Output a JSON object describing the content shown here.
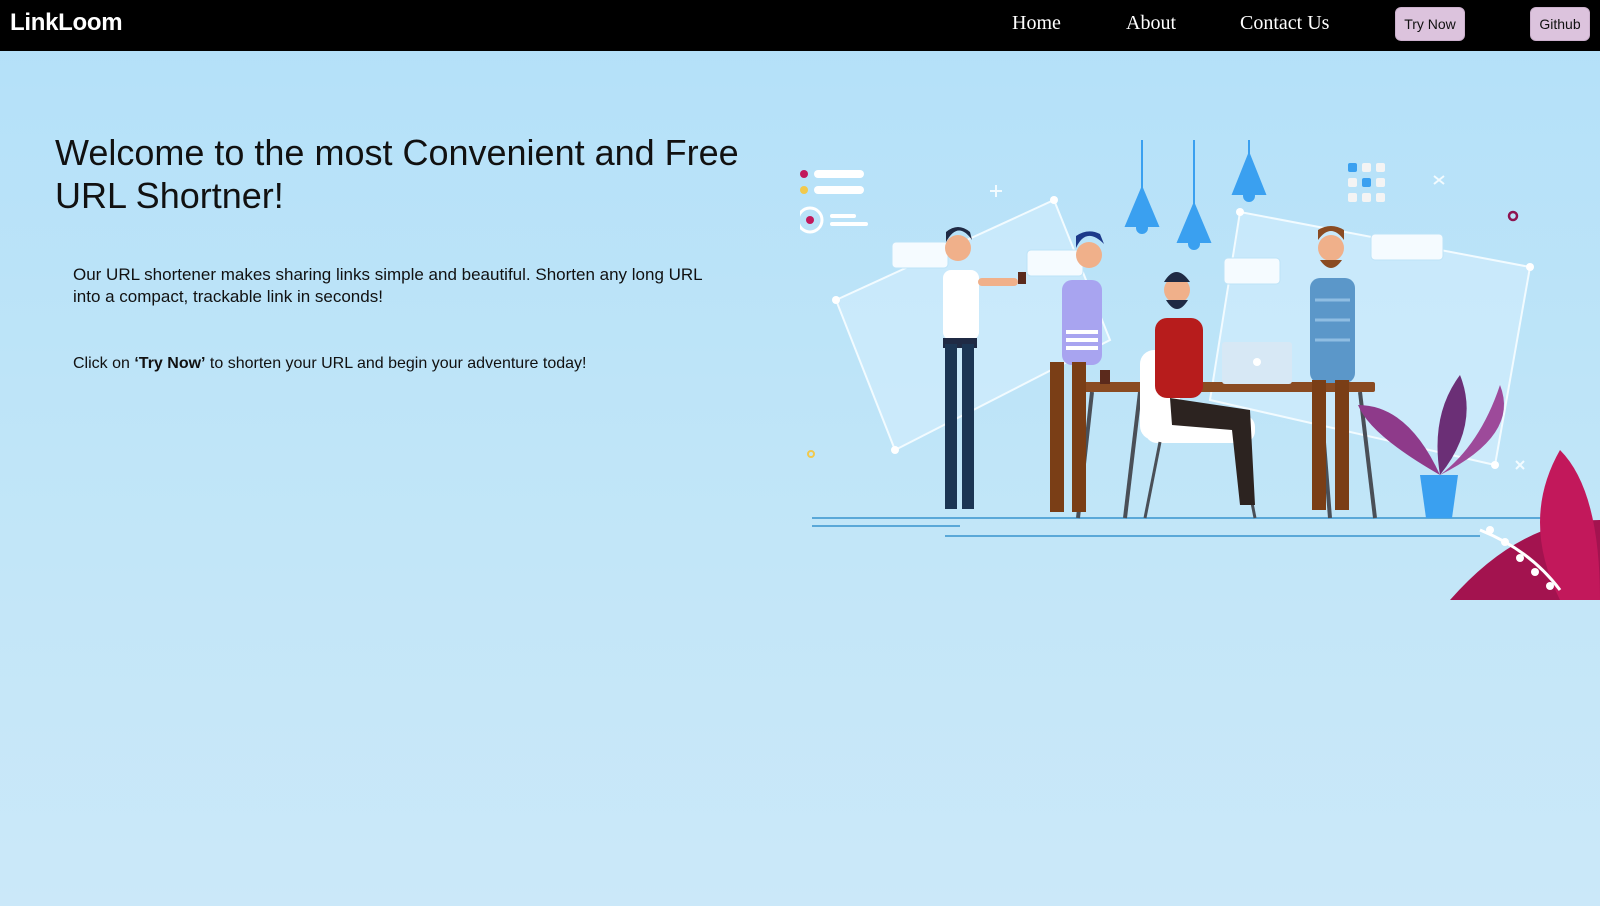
{
  "nav": {
    "brand": "LinkLoom",
    "links": [
      "Home",
      "About",
      "Contact Us"
    ],
    "try_now": "Try Now",
    "github": "Github"
  },
  "hero": {
    "title": "Welcome to the most Convenient and Free URL Shortner!",
    "description": "Our URL shortener makes sharing links simple and beautiful. Shorten any long URL into a compact, trackable link in seconds!",
    "cta_prefix": "Click on ",
    "cta_bold": "‘Try Now’",
    "cta_suffix": " to shorten your URL and begin your adventure today!"
  },
  "colors": {
    "navbar": "#000000",
    "button_bg": "#dcc3dd",
    "page_bg_top": "#b3e0f9",
    "page_bg_bottom": "#cbe8f9"
  }
}
